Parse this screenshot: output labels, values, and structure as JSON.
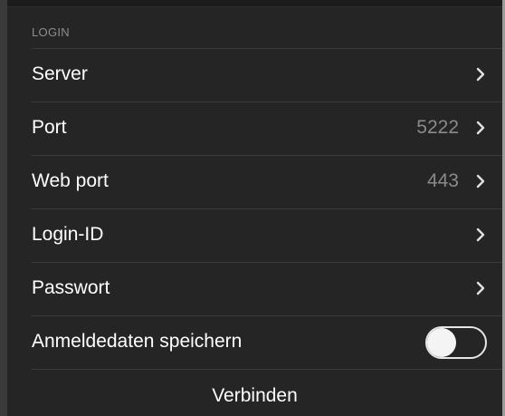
{
  "section": {
    "title": "LOGIN"
  },
  "rows": [
    {
      "label": "Server",
      "value": ""
    },
    {
      "label": "Port",
      "value": "5222"
    },
    {
      "label": "Web port",
      "value": "443"
    },
    {
      "label": "Login-ID",
      "value": ""
    },
    {
      "label": "Passwort",
      "value": ""
    }
  ],
  "save_credentials": {
    "label": "Anmeldedaten speichern",
    "enabled": false
  },
  "connect": {
    "label": "Verbinden"
  },
  "colors": {
    "background": "#252525",
    "text": "#ffffff",
    "secondary_text": "#8a8a8a",
    "header_text": "#8d8d8d",
    "divider": "#3a3a3a"
  },
  "icons": {
    "row_chevron": "chevron-right-icon"
  }
}
